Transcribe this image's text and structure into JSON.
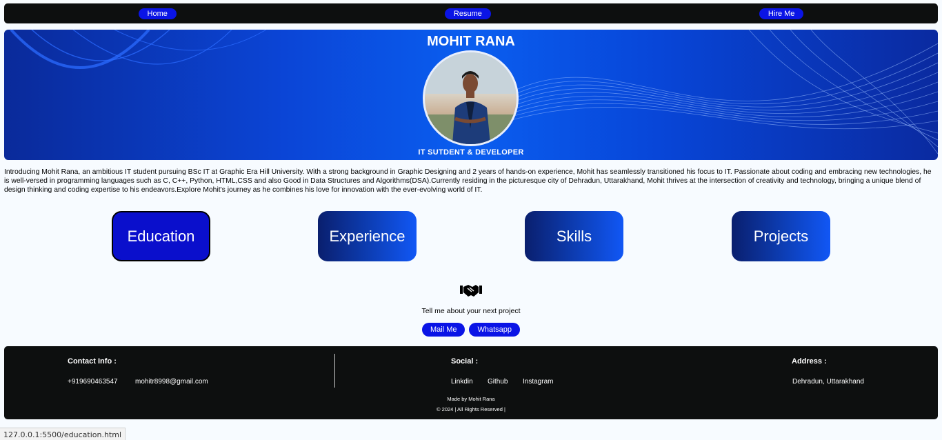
{
  "nav": {
    "items": [
      "Home",
      "Resume",
      "Hire Me"
    ]
  },
  "hero": {
    "name": "MOHIT RANA",
    "role": "IT SUTDENT & DEVELOPER"
  },
  "intro": "Introducing Mohit Rana, an ambitious IT student pursuing BSc IT at Graphic Era Hill University. With a strong background in Graphic Designing and 2 years of hands-on experience, Mohit has seamlessly transitioned his focus to IT. Passionate about coding and embracing new technologies, he is well-versed in programming languages such as C, C++, Python, HTML,CSS and also Good in Data Structures and Algorithms(DSA).Currently residing in the picturesque city of Dehradun, Uttarakhand, Mohit thrives at the intersection of creativity and technology, bringing a unique blend of design thinking and coding expertise to his endeavors.Explore Mohit's journey as he combines his love for innovation with the ever-evolving world of IT.",
  "sections": [
    "Education",
    "Experience",
    "Skills",
    "Projects"
  ],
  "cta": {
    "icon": "handshake-icon",
    "text": "Tell me about your next project",
    "mail_label": "Mail Me",
    "whatsapp_label": "Whatsapp"
  },
  "footer": {
    "contact_heading": "Contact Info :",
    "phone": "+919690463547",
    "email": "mohitr8998@gmail.com",
    "social_heading": "Social :",
    "social_links": [
      "Linkdin",
      "Github",
      "Instagram"
    ],
    "address_heading": "Address :",
    "address": "Dehradun, Uttarakhand",
    "made_by": "Made by Mohit Rana",
    "copyright": "© 2024 | All Rights Reserved |"
  },
  "status_bar": {
    "url": "127.0.0.1:5500/education.html"
  },
  "colors": {
    "nav_button": "#0a14e6",
    "bar_bg": "#0d0f0f",
    "page_bg": "#f7fbff"
  }
}
